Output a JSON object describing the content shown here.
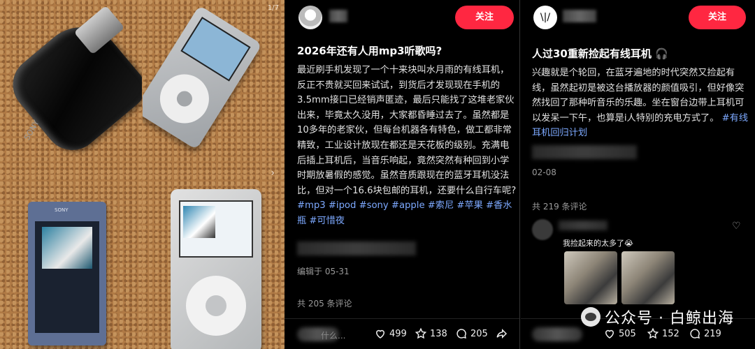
{
  "gallery": {
    "counter": "1/7",
    "next_glyph": "›",
    "labels": {
      "sony_1": "SONY",
      "sony_2": "SONY"
    }
  },
  "post1": {
    "follow_label": "关注",
    "title": "2026年还有人用mp3听歌吗?",
    "body": "最近刷手机发现了一个十来块叫水月雨的有线耳机，反正不贵就买回来试试，到货后才发现现在手机的3.5mm接口已经销声匿迹，最后只能找了这堆老家伙出来，毕竟太久没用，大家都昏睡过去了。虽然都是10多年的老家伙，但每台机器各有特色，做工都非常精致，工业设计放现在都还是天花板的级别。充满电后插上耳机后，当音乐响起，竟然突然有种回到小学时期放暑假的感觉。虽然音质跟现在的蓝牙耳机没法比，但对一个16.6块包邮的耳机，还要什么自行车呢?",
    "tags": "#mp3 #ipod #sony #apple #索尼 #苹果 #香水瓶 #可惜夜",
    "edited": "编辑于 05-31",
    "comments": "共 205 条评论",
    "input_placeholder": "什么...",
    "likes": "499",
    "collects": "138",
    "comment_count": "205"
  },
  "post2": {
    "avatar_glyph": "\\|/",
    "follow_label": "关注",
    "title": "人过30重新捡起有线耳机 🎧",
    "body": "兴趣就是个轮回，在蓝牙遍地的时代突然又捡起有线，虽然起初是被这台播放器的颜值吸引，但好像突然找回了那种听音乐的乐趣。坐在窗台边带上耳机可以发呆一下午，也算是i人特别的充电方式了。",
    "tags": "#有线耳机回归计划",
    "date": "02-08",
    "comments": "共 219 条评论",
    "comment_text": "我捡起来的太多了😭",
    "likes": "505",
    "collects": "152",
    "comment_count": "219"
  },
  "watermark": "公众号 · 白鲸出海"
}
